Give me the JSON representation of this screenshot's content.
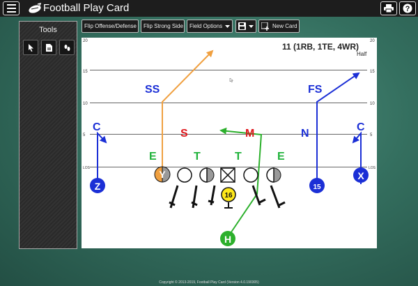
{
  "app": {
    "title": "Football Play Card",
    "copyright": "Copyright © 2013-2019, Football Play Card (Version 4.0.190305)"
  },
  "tools": {
    "title": "Tools"
  },
  "toolbar": {
    "flip_offense_defense": "Flip Offense/Defense",
    "flip_strong_side": "Flip Strong Side",
    "field_options": "Field Options",
    "new_card": "New Card"
  },
  "field": {
    "formation": "11 (1RB, 1TE, 4WR)",
    "field_type": "Half",
    "yard_lines": {
      "y20": "20",
      "y15": "15",
      "y10": "10",
      "y5": "5",
      "los": "LOS"
    }
  },
  "players": {
    "ss": "SS",
    "fs": "FS",
    "c_left": "C",
    "c_right": "C",
    "s": "S",
    "m": "M",
    "n": "N",
    "e_left": "E",
    "t_left": "T",
    "t_right": "T",
    "e_right": "E",
    "y": "Y",
    "z": "Z",
    "x": "X",
    "qb": "16",
    "wr15": "15",
    "h": "H"
  },
  "colors": {
    "blue": "#1b2fd6",
    "red": "#e0181d",
    "green": "#1fb23a",
    "orange": "#f0a040",
    "line_green": "#2cb02c"
  }
}
